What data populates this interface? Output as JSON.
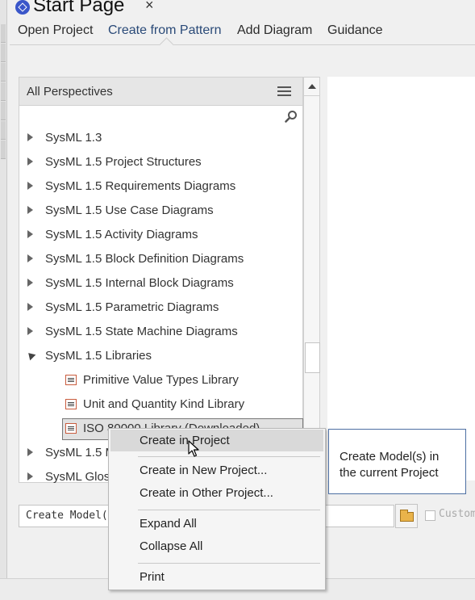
{
  "title": {
    "text": "Start Page",
    "close": "×"
  },
  "tabs": [
    {
      "label": "Open Project"
    },
    {
      "label": "Create from Pattern"
    },
    {
      "label": "Add Diagram"
    },
    {
      "label": "Guidance"
    }
  ],
  "panel": {
    "title": "All Perspectives",
    "items": [
      {
        "label": "SysML 1.3"
      },
      {
        "label": "SysML 1.5 Project Structures"
      },
      {
        "label": "SysML 1.5 Requirements Diagrams"
      },
      {
        "label": "SysML 1.5 Use Case Diagrams"
      },
      {
        "label": "SysML 1.5 Activity Diagrams"
      },
      {
        "label": "SysML 1.5 Block Definition Diagrams"
      },
      {
        "label": "SysML 1.5 Internal Block Diagrams"
      },
      {
        "label": "SysML 1.5 Parametric Diagrams"
      },
      {
        "label": "SysML 1.5 State Machine Diagrams"
      },
      {
        "label": "SysML 1.5 Libraries"
      },
      {
        "label": "Primitive Value Types Library"
      },
      {
        "label": "Unit and Quantity Kind Library"
      },
      {
        "label": "ISO 80000 Library (Downloaded)"
      },
      {
        "label": "SysML 1.5 M"
      },
      {
        "label": "SysML Gloss"
      }
    ]
  },
  "context_menu": {
    "items": [
      {
        "label": "Create in Project"
      },
      {
        "label": "Create in New Project..."
      },
      {
        "label": "Create in Other Project..."
      },
      {
        "label": "Expand All"
      },
      {
        "label": "Collapse All"
      },
      {
        "label": "Print"
      }
    ]
  },
  "tooltip": {
    "line1": "Create Model(s) in",
    "line2": "the current Project"
  },
  "bottom": {
    "field_value": "Create Model(",
    "custom_label": "Custom"
  },
  "colors": {
    "accent_tab": "#2a4a78",
    "tooltip_border": "#4d6fa3",
    "menu_highlight": "#d9d9d9"
  },
  "icons": [
    "start-page-icon",
    "close-icon",
    "hamburger-menu-icon",
    "search-icon",
    "expand-triangle-icon",
    "package-icon",
    "folder-icon",
    "mouse-cursor-icon"
  ]
}
